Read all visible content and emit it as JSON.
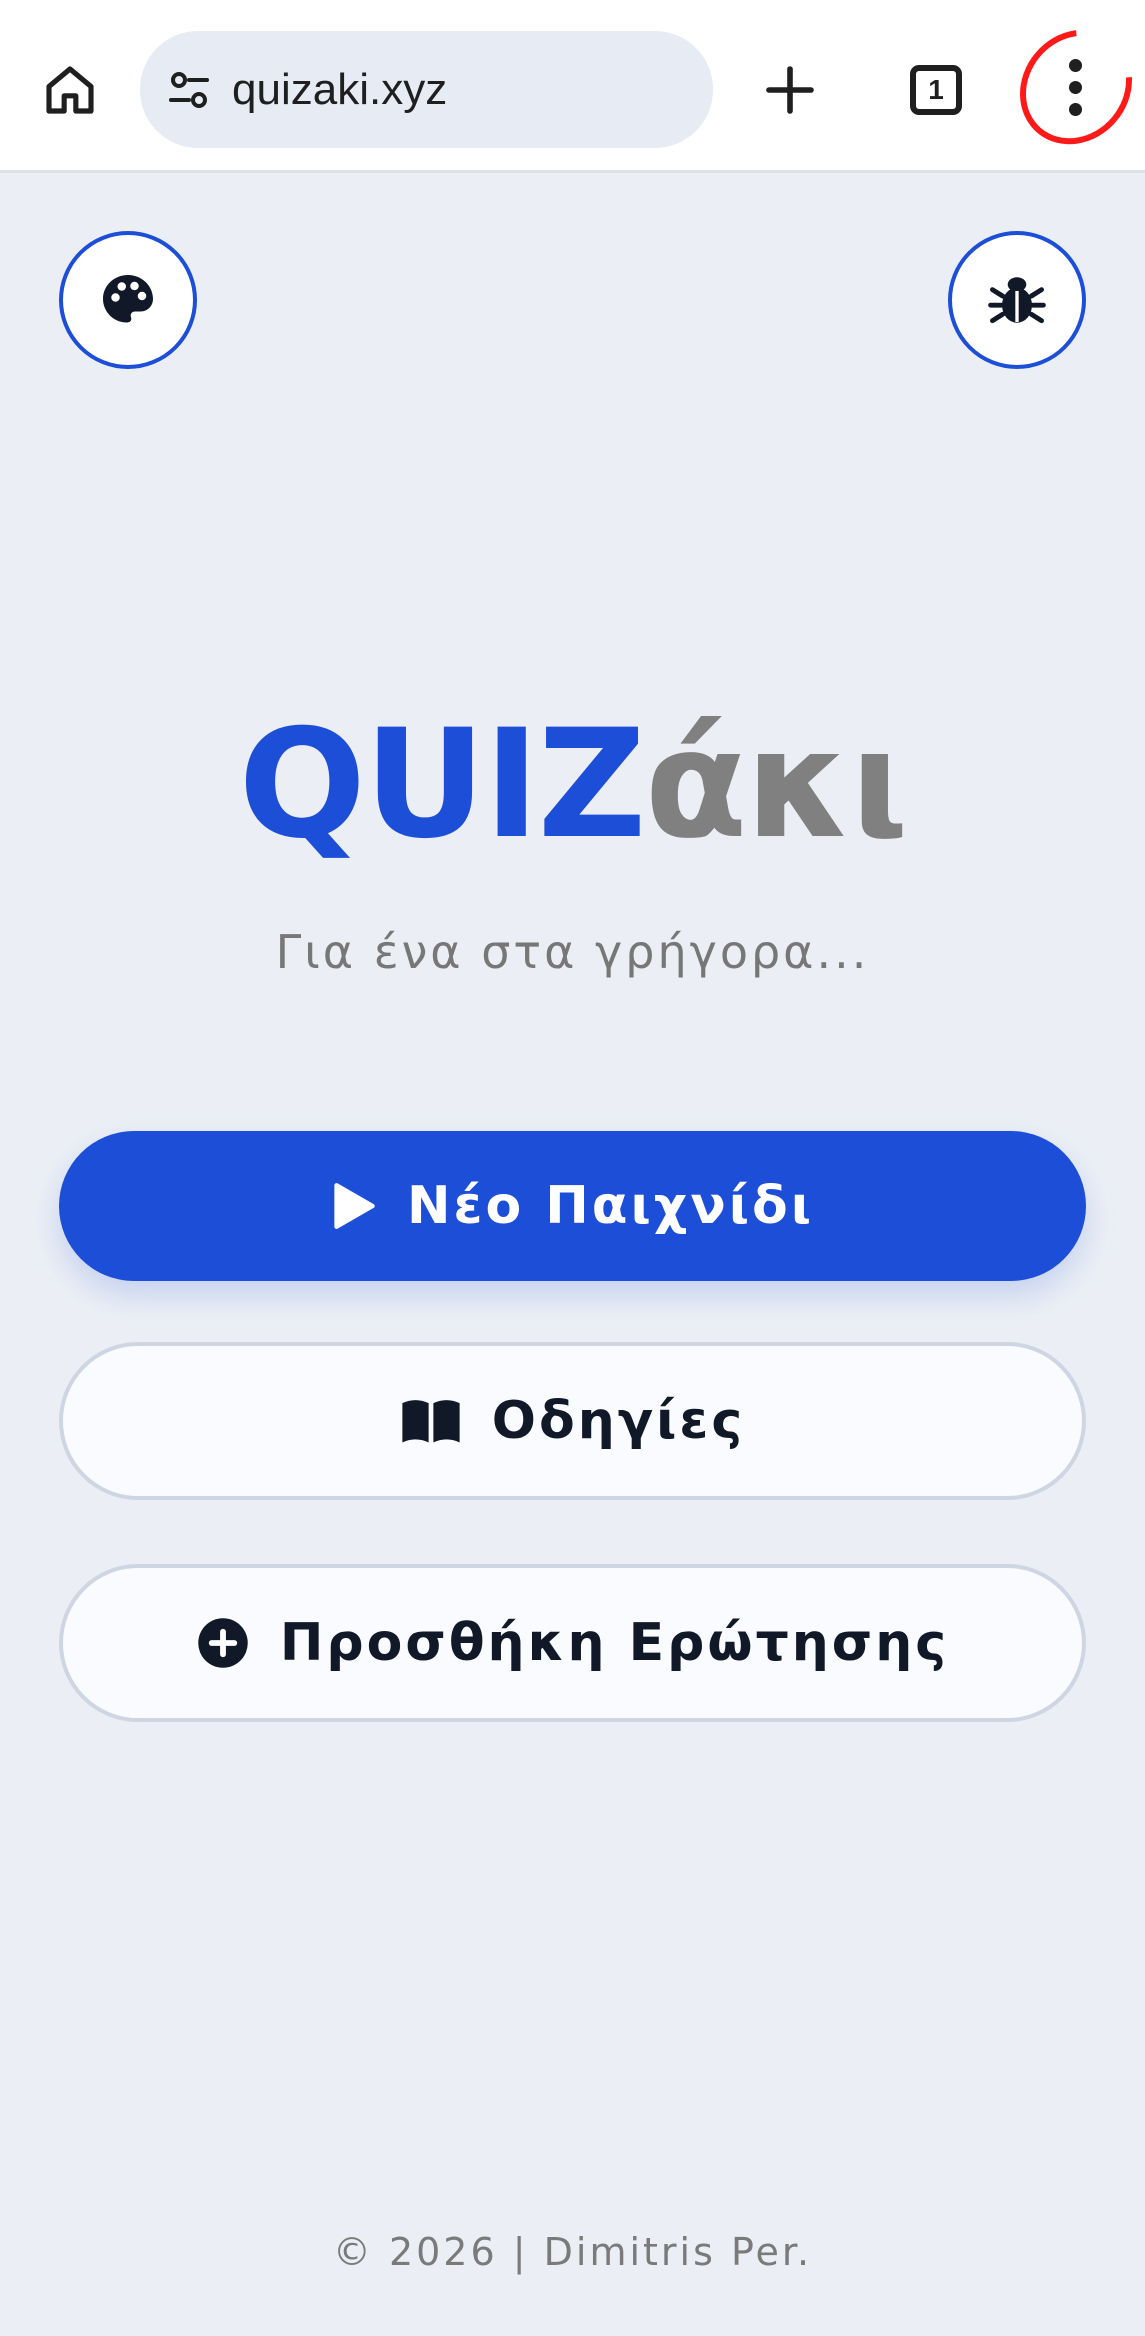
{
  "browser": {
    "url": "quizaki.xyz",
    "tab_count": "1"
  },
  "app": {
    "logo_main": "QUIZ",
    "logo_suffix": "άκι",
    "tagline": "Για ένα στα γρήγορα...",
    "buttons": {
      "new_game": "Νέο Παιχνίδι",
      "instructions": "Οδηγίες",
      "add_question": "Προσθήκη Ερώτησης"
    },
    "footer": "© 2026 | Dimitris Per."
  },
  "icons": {
    "home": "home-icon",
    "site_settings": "tune-icon",
    "new_tab": "plus-icon",
    "tabs": "tabs-icon",
    "menu": "more-vert-icon",
    "theme": "palette-icon",
    "debug": "bug-icon",
    "play": "play-icon",
    "book": "book-open-icon",
    "add": "plus-circle-icon"
  },
  "colors": {
    "primary": "#1d4ed8",
    "logo_gray": "#808080",
    "background": "#ebeff5",
    "highlight_ring": "#ff1a1a"
  }
}
